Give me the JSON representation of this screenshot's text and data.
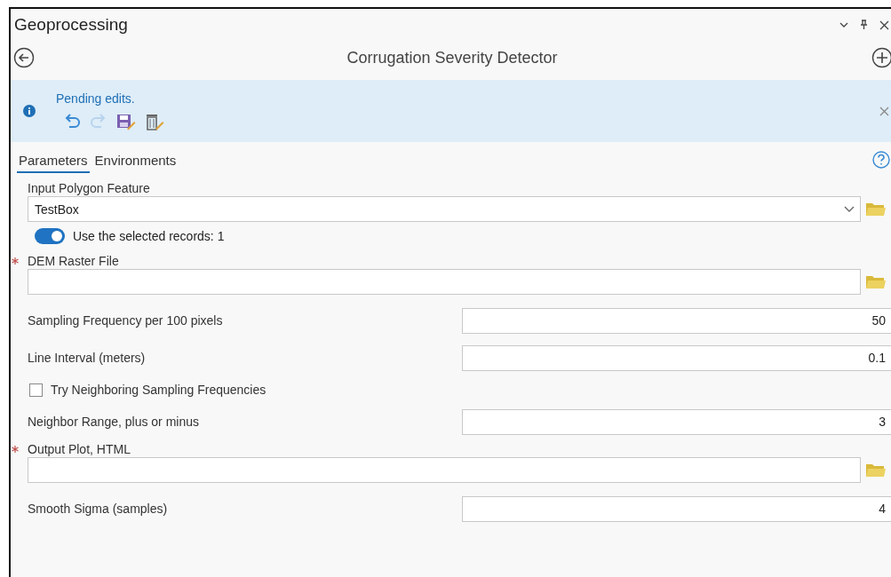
{
  "pane": {
    "title": "Geoprocessing"
  },
  "tool": {
    "title": "Corrugation Severity Detector"
  },
  "banner": {
    "message": "Pending edits."
  },
  "tabs": [
    {
      "label": "Parameters",
      "selected": true
    },
    {
      "label": "Environments",
      "selected": false
    }
  ],
  "parameters": [
    {
      "kind": "combo",
      "label": "Input Polygon Feature",
      "required": false,
      "value": "TestBox",
      "toggle": {
        "label": "Use the selected records: 1",
        "on": true
      }
    },
    {
      "kind": "file",
      "label": "DEM Raster File",
      "required": true
    },
    {
      "kind": "number",
      "label": "Sampling Frequency per 100 pixels",
      "value": "50"
    },
    {
      "kind": "number",
      "label": "Line Interval (meters)",
      "value": "0.1"
    },
    {
      "kind": "checkbox",
      "label": "Try Neighboring Sampling Frequencies",
      "checked": false
    },
    {
      "kind": "number",
      "label": "Neighbor Range, plus or minus",
      "value": "3"
    },
    {
      "kind": "file",
      "label": "Output Plot, HTML",
      "required": true
    },
    {
      "kind": "number",
      "label": "Smooth Sigma (samples)",
      "value": "4"
    }
  ]
}
